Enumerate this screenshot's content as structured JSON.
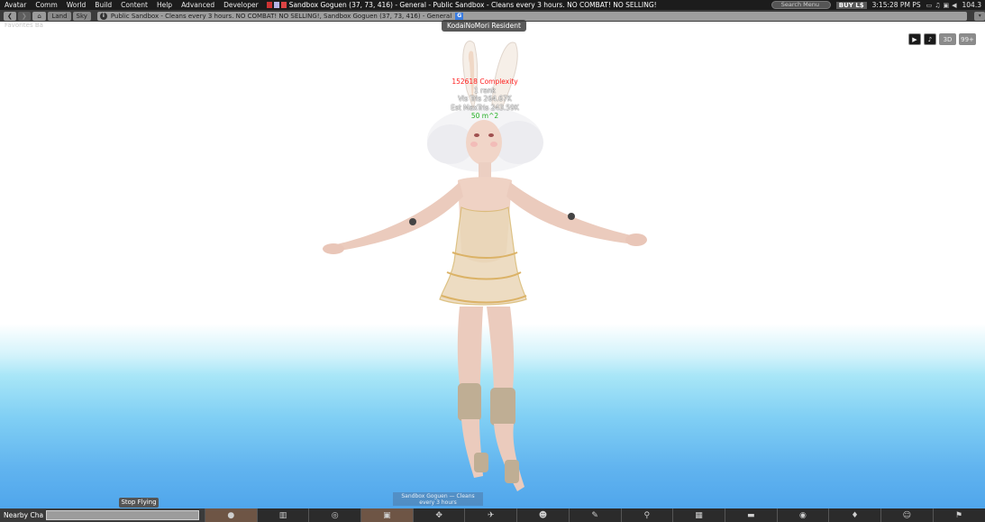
{
  "menubar": {
    "items": [
      "Avatar",
      "Comm",
      "World",
      "Build",
      "Content",
      "Help",
      "Advanced",
      "Developer"
    ],
    "location": "Sandbox Goguen (37, 73, 416) - General - Public Sandbox - Cleans every 3 hours. NO COMBAT! NO SELLING!",
    "search_placeholder": "Search Menu",
    "buy_label": "BUY L$",
    "time": "3:15:28 PM PS",
    "fps": "104.3"
  },
  "navbar": {
    "land_label": "Land",
    "sky_label": "Sky",
    "location": "Public Sandbox - Cleans every 3 hours. NO COMBAT! NO SELLING!, Sandbox Goguen (37, 73, 416) - General",
    "g_label": "G"
  },
  "favorites_label": "Favorites Ba",
  "nametag": "KodaiNoMori Resident",
  "topright": {
    "three_d_label": "3D",
    "fps_label": "99+"
  },
  "hovertext": {
    "complexity": "152618 Complexity",
    "rank": "1 rank",
    "visible": "Vis Tris 264.67K",
    "est_max": "Est MaxTris 243.59K",
    "area": "50 m^2"
  },
  "stop_flying_label": "Stop Flying",
  "chat": {
    "label": "Nearby Cha"
  },
  "notice_text": "Sandbox Goguen — Cleans every 3 hours",
  "toolbar": {
    "buttons": [
      "chat-icon",
      "inventory-icon",
      "radar-icon",
      "snapshot-icon",
      "build-icon",
      "fly-icon",
      "people-icon",
      "gestures-icon",
      "search-icon",
      "map-icon",
      "camera-icon",
      "view-icon",
      "outfit-icon",
      "avatar-icon",
      "places-icon"
    ]
  },
  "colors": {
    "complexity": "#ff2020",
    "area": "#22b022",
    "toolbar_active": "#6e5545",
    "menubar_bg": "#1c1c1c"
  }
}
